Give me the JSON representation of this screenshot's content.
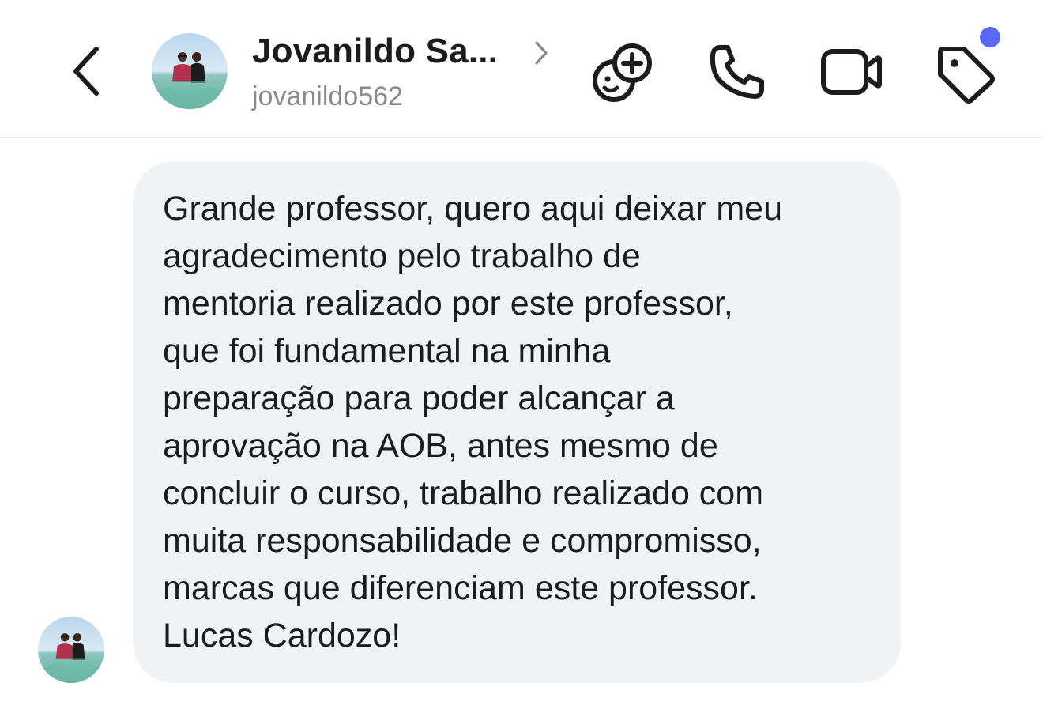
{
  "header": {
    "back_icon": "chevron-left-icon",
    "contact_name": "Jovanildo Sa...",
    "username": "jovanildo562",
    "actions": [
      {
        "icon": "effects-plus-face-icon"
      },
      {
        "icon": "phone-icon"
      },
      {
        "icon": "video-camera-icon"
      },
      {
        "icon": "tag-icon"
      }
    ],
    "notification_dot_color": "#5b68f5"
  },
  "message": {
    "text": "Grande professor, quero aqui deixar meu\nagradecimento pelo trabalho de\nmentoria realizado por este professor,\nque foi fundamental na minha\npreparação para poder alcançar a\naprovação na AOB, antes mesmo de\nconcluir o curso, trabalho realizado com\nmuita responsabilidade e compromisso,\nmarcas que diferenciam este professor.\nLucas Cardozo!",
    "bubble_color": "#f1f2f4"
  }
}
